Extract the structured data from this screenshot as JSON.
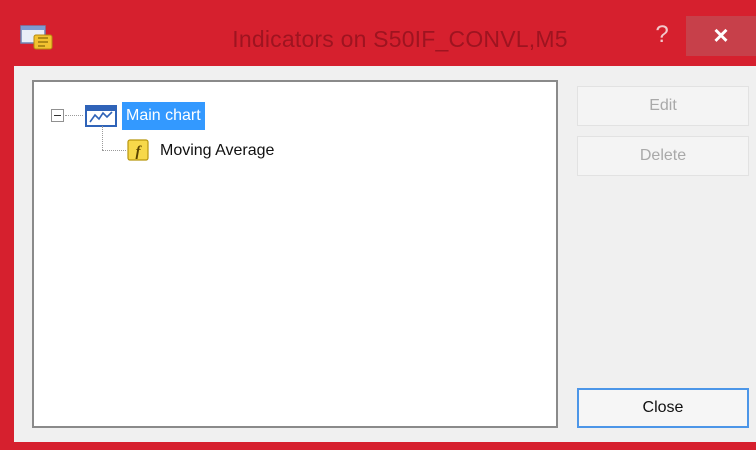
{
  "window": {
    "title": "Indicators on S50IF_CONVL,M5",
    "help_label": "?",
    "close_label": "×"
  },
  "tree": {
    "root": {
      "label": "Main chart",
      "expanded": true,
      "selected": true,
      "icon": "chart-window-icon"
    },
    "children": [
      {
        "label": "Moving Average",
        "icon": "indicator-function-icon"
      }
    ]
  },
  "buttons": {
    "edit": "Edit",
    "delete": "Delete",
    "close": "Close"
  },
  "colors": {
    "titlebar": "#d6202e",
    "selection": "#3399ff",
    "default_button_border": "#4c96e8"
  }
}
